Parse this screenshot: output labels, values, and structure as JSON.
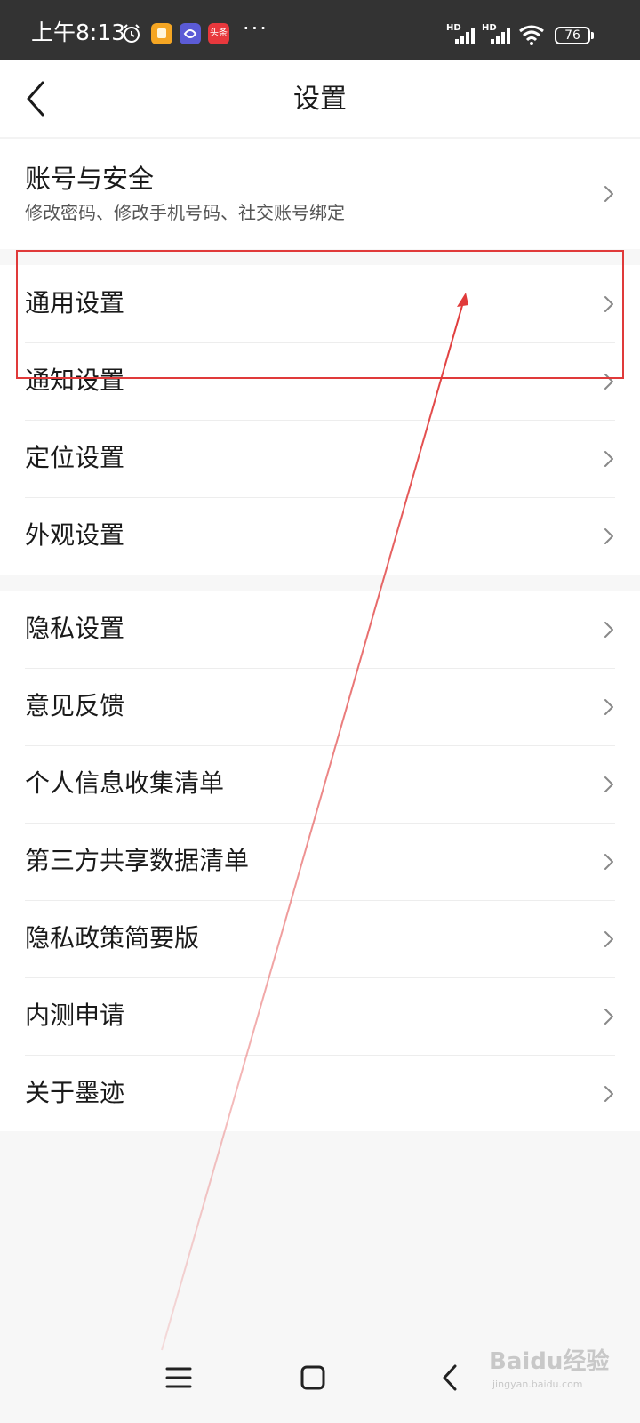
{
  "status_bar": {
    "time": "上午8:13",
    "more_indicator": "···",
    "battery_level": "76",
    "network_labels": [
      "HD",
      "HD"
    ],
    "icons": [
      "alarm-icon",
      "notes-app-icon",
      "browser-app-icon",
      "toutiao-app-icon",
      "signal-icon",
      "signal-icon",
      "wifi-icon",
      "battery-icon"
    ],
    "notification_app_labels": [
      "头条"
    ]
  },
  "header": {
    "title": "设置",
    "back_icon": "back-arrow-icon"
  },
  "sections": [
    {
      "items": [
        {
          "label": "账号与安全",
          "sublabel": "修改密码、修改手机号码、社交账号绑定"
        }
      ]
    },
    {
      "items": [
        {
          "label": "通用设置"
        },
        {
          "label": "通知设置"
        },
        {
          "label": "定位设置"
        },
        {
          "label": "外观设置"
        }
      ]
    },
    {
      "items": [
        {
          "label": "隐私设置"
        },
        {
          "label": "意见反馈"
        },
        {
          "label": "个人信息收集清单"
        },
        {
          "label": "第三方共享数据清单"
        },
        {
          "label": "隐私政策简要版"
        },
        {
          "label": "内测申请"
        },
        {
          "label": "关于墨迹"
        }
      ]
    }
  ],
  "nav_bar": {
    "icons": [
      "menu-icon",
      "home-icon",
      "back-icon"
    ]
  },
  "watermark": {
    "brand": "Baidu经验",
    "url": "jingyan.baidu.com"
  },
  "colors": {
    "status_bar_bg": "#333333",
    "page_bg": "#f7f7f7",
    "card_bg": "#ffffff",
    "annotation_red": "#e03a3a"
  }
}
